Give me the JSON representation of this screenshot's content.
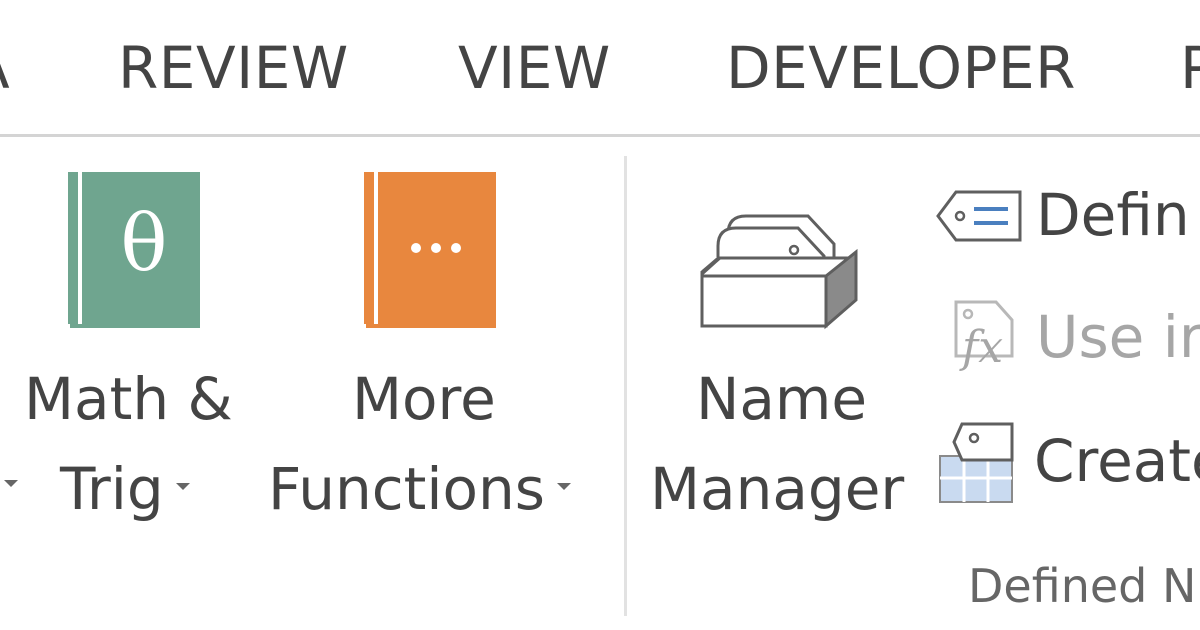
{
  "tabs": [
    {
      "label": "A"
    },
    {
      "label": "REVIEW"
    },
    {
      "label": "VIEW"
    },
    {
      "label": "DEVELOPER"
    },
    {
      "label": "P"
    }
  ],
  "buttons": {
    "left_edge_caret": "",
    "math_trig": {
      "line1": "Math &",
      "line2": "Trig",
      "icon": "theta-book-icon"
    },
    "more_functions": {
      "line1": "More",
      "line2": "Functions",
      "icon": "ellipsis-book-icon"
    },
    "name_manager": {
      "line1": "Name",
      "line2": "Manager",
      "icon": "name-tags-box-icon"
    }
  },
  "small_buttons": {
    "define_name": {
      "label": "Defin",
      "icon": "name-tag-icon"
    },
    "use_in_formula": {
      "label": "Use ir",
      "icon": "fx-tag-icon",
      "disabled": true
    },
    "create_from_selection": {
      "label": "Create",
      "icon": "tag-grid-icon"
    }
  },
  "groups": {
    "defined_names": {
      "label": "Defined N"
    }
  },
  "colors": {
    "math_trig_book": "#6fa58f",
    "more_functions_book": "#e8873e",
    "separator": "#e2e2e2",
    "text": "#444444",
    "disabled_text": "#a6a6a6"
  }
}
